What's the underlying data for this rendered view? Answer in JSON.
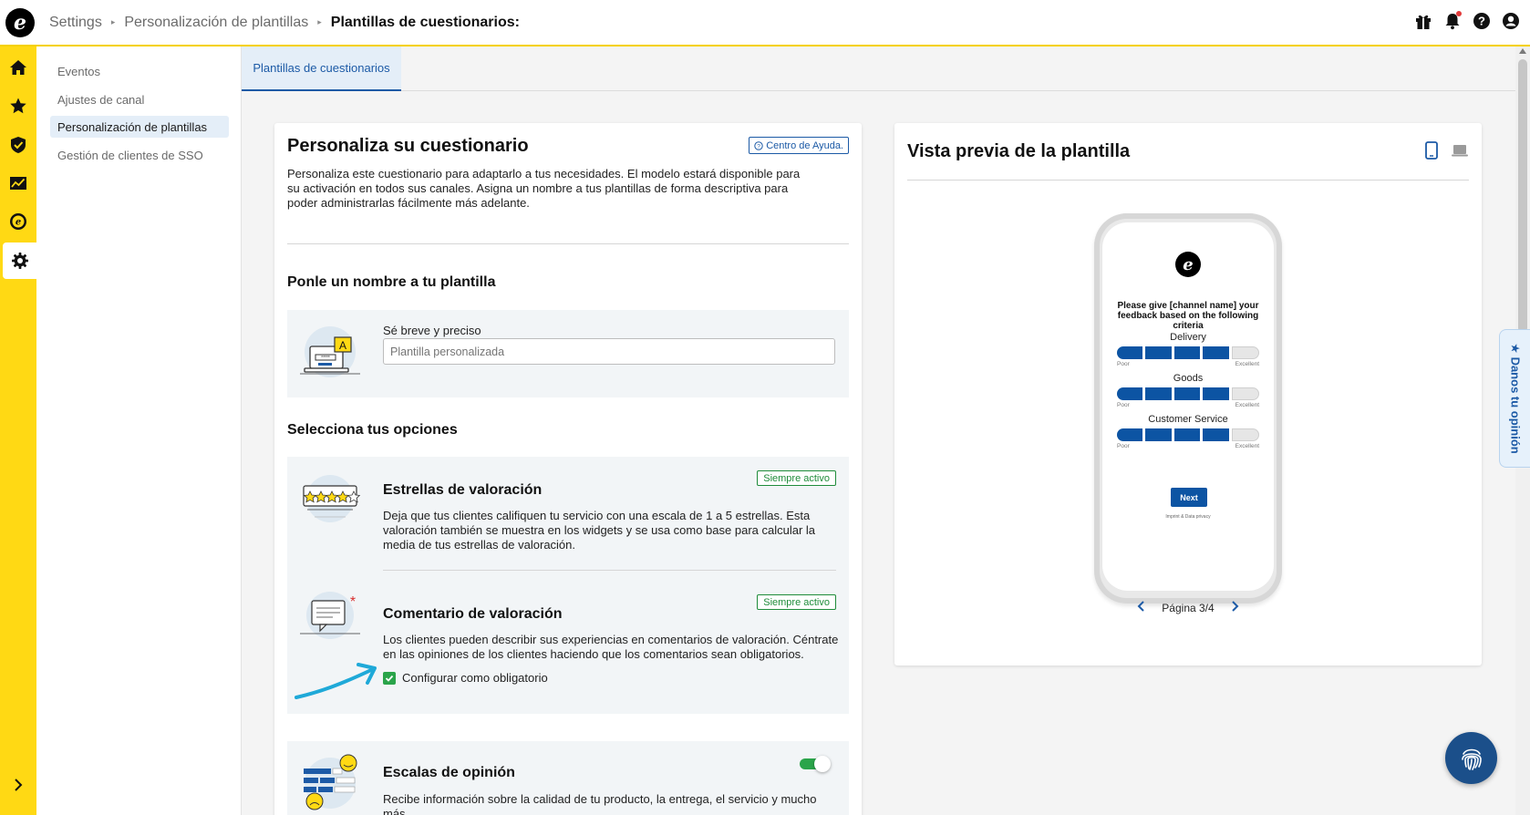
{
  "header": {
    "breadcrumb": [
      "Settings",
      "Personalización de plantillas"
    ],
    "current": "Plantillas de cuestionarios:"
  },
  "subnav": {
    "items": [
      {
        "label": "Eventos"
      },
      {
        "label": "Ajustes de canal"
      },
      {
        "label": "Personalización de plantillas",
        "active": true
      },
      {
        "label": "Gestión de clientes de SSO"
      }
    ]
  },
  "tabs": {
    "active": "Plantillas de cuestionarios"
  },
  "customize": {
    "title": "Personaliza su cuestionario",
    "help_link": "Centro de Ayuda.",
    "intro": "Personaliza este cuestionario para adaptarlo a tus necesidades. El modelo estará disponible para su activación en todos sus canales. Asigna un nombre a tus plantillas de forma descriptiva para poder administrarlas fácilmente más adelante.",
    "name_section": {
      "title": "Ponle un nombre a tu plantilla",
      "label": "Sé breve y preciso",
      "placeholder": "Plantilla personalizada",
      "illustration_letter": "A"
    },
    "options_title": "Selecciona tus opciones",
    "options": {
      "stars": {
        "title": "Estrellas de valoración",
        "badge": "Siempre activo",
        "desc": "Deja que tus clientes califiquen tu servicio con una escala de 1 a 5 estrellas. Esta valoración también se muestra en los widgets y se usa como base para calcular la media de tus estrellas de valoración."
      },
      "comment": {
        "title": "Comentario de valoración",
        "badge": "Siempre activo",
        "desc": "Los clientes pueden describir sus experiencias en comentarios de valoración. Céntrate en las opiniones de los clientes haciendo que los comentarios sean obligatorios.",
        "checkbox_label": "Configurar como obligatorio",
        "checked": true
      },
      "scales": {
        "title": "Escalas de opinión",
        "desc": "Recibe información sobre la calidad de tu producto, la entrega, el servicio y mucho más.",
        "enabled": true
      }
    }
  },
  "preview": {
    "title": "Vista previa de la plantilla",
    "question": "Please give [channel name] your feedback based on the following criteria",
    "criteria": [
      {
        "label": "Delivery",
        "value": 4,
        "max": 5
      },
      {
        "label": "Goods",
        "value": 4,
        "max": 5
      },
      {
        "label": "Customer Service",
        "value": 4,
        "max": 5
      }
    ],
    "scale_low": "Poor",
    "scale_high": "Excellent",
    "next_label": "Next",
    "imprint": "Imprint & Data privacy",
    "page_label": "Página 3/4"
  },
  "feedback_tab": "Danos tu opinión",
  "colors": {
    "accent": "#1c5aa6",
    "rail": "#ffd914",
    "success": "#2aa44a",
    "rating_blue": "#0c54a3"
  }
}
